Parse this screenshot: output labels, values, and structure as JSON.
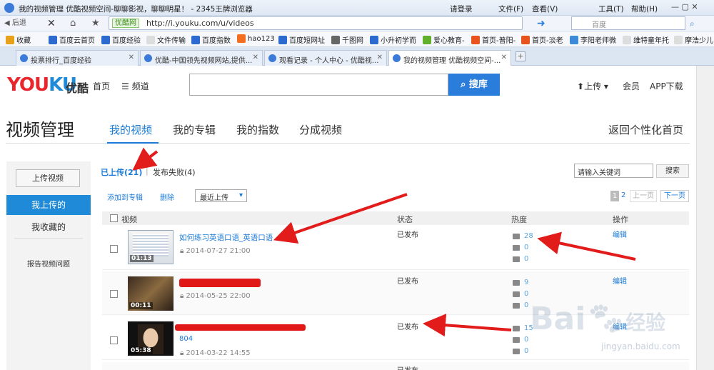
{
  "browser": {
    "title": "我的视频管理 优酷视频空间-聊聊影视，聊聊明星！ - 2345王牌浏览器",
    "menu": [
      "请登录",
      "文件(F)",
      "查看(V)",
      "工具(T)",
      "帮助(H)"
    ],
    "back": "后退",
    "secure": "优酷网",
    "url": "http://i.youku.com/u/videos",
    "search_placeholder": "百度",
    "bookmarks": [
      "收藏",
      "百度云首页",
      "百度经验",
      "文件传输",
      "百度指数",
      "hao123",
      "百度短网址",
      "千图网",
      "小升初学而",
      "爱心教育-",
      "首页-普阳-",
      "首页-淡老",
      "李阳老师微",
      "维特童年托",
      "摩浩少儿"
    ],
    "tabs": [
      "投票排行_百度经验",
      "优酷-中国领先视频网站,提供...",
      "观看记录 - 个人中心 - 优酷视...",
      "我的视频管理 优酷视频空间-..."
    ]
  },
  "youku": {
    "logo_main": "YOU",
    "logo_accent": "KU",
    "logo_cn": "优酷",
    "nav_home": "首页",
    "nav_channel": "频道",
    "search_btn": "搜库",
    "upload": "上传",
    "member": "会员",
    "app": "APP下载"
  },
  "page": {
    "title": "视频管理",
    "tabs": [
      "我的视频",
      "我的专辑",
      "我的指数",
      "分成视频"
    ],
    "back_home": "返回个性化首页"
  },
  "sidebar": {
    "upload_btn": "上传视频",
    "items": [
      "我上传的",
      "我收藏的"
    ],
    "report": "报告视频问题"
  },
  "filters": {
    "uploaded": "已上传(21)",
    "failed": "发布失败(4)",
    "search_placeholder": "请输入关键词",
    "search_btn": "搜索"
  },
  "actions": {
    "add_album": "添加到专辑",
    "delete": "删除",
    "sort": "最近上传"
  },
  "pager": {
    "current": "1",
    "next_num": "2",
    "prev": "上一页",
    "next": "下一页"
  },
  "table": {
    "headers": [
      "视频",
      "状态",
      "热度",
      "操作"
    ],
    "rows": [
      {
        "title": "如何练习英语口语_英语口语",
        "date": "2014-07-27 21:00",
        "duration": "01:13",
        "status": "已发布",
        "plays": "28",
        "comments": "0",
        "fav": "0",
        "action": "编辑"
      },
      {
        "title": "",
        "date": "2014-05-25 22:00",
        "duration": "00:11",
        "status": "已发布",
        "plays": "9",
        "comments": "0",
        "fav": "0",
        "action": "编辑"
      },
      {
        "title": "",
        "subtitle": "804",
        "date": "2014-03-22 14:55",
        "duration": "05:38",
        "status": "已发布",
        "plays": "15",
        "comments": "0",
        "fav": "0",
        "action": "编辑"
      },
      {
        "title": "",
        "date": "",
        "duration": "",
        "status": "已发布",
        "plays": "",
        "comments": "",
        "fav": "",
        "action": ""
      }
    ]
  },
  "watermark": {
    "brand": "Bai",
    "brand2": "经验",
    "url": "jingyan.baidu.com"
  }
}
